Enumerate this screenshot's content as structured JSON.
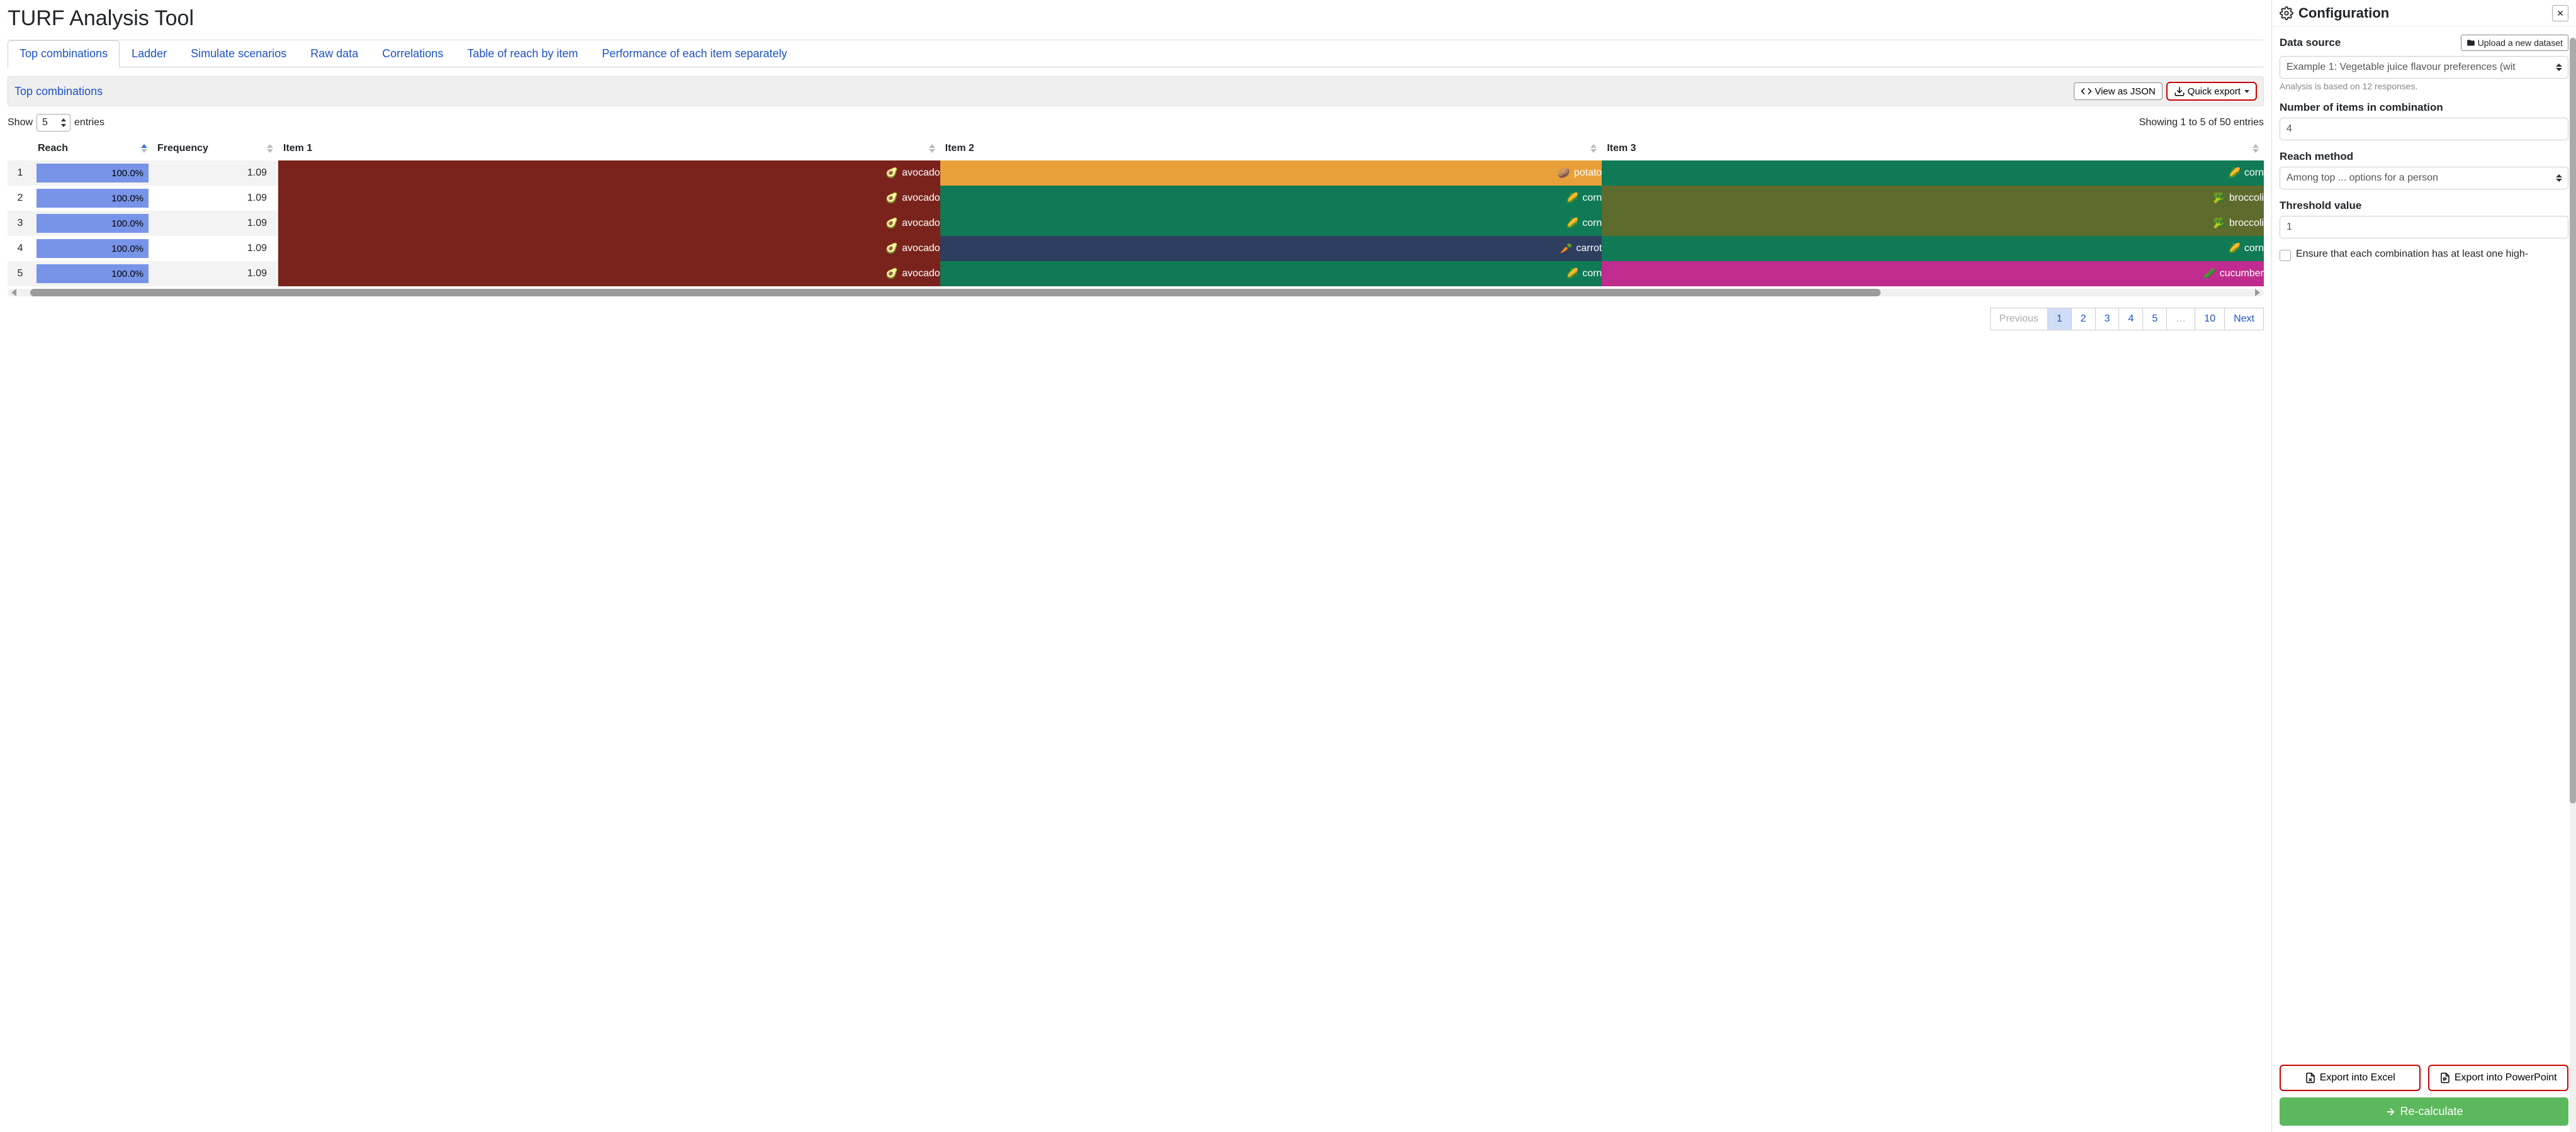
{
  "app_title": "TURF Analysis Tool",
  "tabs": [
    {
      "label": "Top combinations",
      "active": true
    },
    {
      "label": "Ladder",
      "active": false
    },
    {
      "label": "Simulate scenarios",
      "active": false
    },
    {
      "label": "Raw data",
      "active": false
    },
    {
      "label": "Correlations",
      "active": false
    },
    {
      "label": "Table of reach by item",
      "active": false
    },
    {
      "label": "Performance of each item separately",
      "active": false
    }
  ],
  "panel": {
    "title": "Top combinations",
    "view_json_btn": "View as JSON",
    "quick_export_btn": "Quick export"
  },
  "table_controls": {
    "show_label_pre": "Show",
    "show_value": "5",
    "show_label_post": "entries",
    "showing_text": "Showing 1 to 5 of 50 entries"
  },
  "columns": [
    "Reach",
    "Frequency",
    "Item 1",
    "Item 2",
    "Item 3"
  ],
  "item_colors": {
    "avocado": "#7a231c",
    "potato": "#e8a13a",
    "corn": "#0f7a55",
    "broccoli": "#5d6b2d",
    "carrot": "#2d3e5f",
    "cucumber": "#c02b8f"
  },
  "item_emoji": {
    "avocado": "🥑",
    "potato": "🥔",
    "corn": "🌽",
    "broccoli": "🥦",
    "carrot": "🥕",
    "cucumber": "🥒"
  },
  "rows": [
    {
      "idx": "1",
      "reach": "100.0%",
      "freq": "1.09",
      "items": [
        "avocado",
        "potato",
        "corn"
      ]
    },
    {
      "idx": "2",
      "reach": "100.0%",
      "freq": "1.09",
      "items": [
        "avocado",
        "corn",
        "broccoli"
      ]
    },
    {
      "idx": "3",
      "reach": "100.0%",
      "freq": "1.09",
      "items": [
        "avocado",
        "corn",
        "broccoli"
      ]
    },
    {
      "idx": "4",
      "reach": "100.0%",
      "freq": "1.09",
      "items": [
        "avocado",
        "carrot",
        "corn"
      ]
    },
    {
      "idx": "5",
      "reach": "100.0%",
      "freq": "1.09",
      "items": [
        "avocado",
        "corn",
        "cucumber"
      ]
    }
  ],
  "pagination": {
    "previous": "Previous",
    "pages": [
      "1",
      "2",
      "3",
      "4",
      "5",
      "…",
      "10"
    ],
    "active_page": "1",
    "next": "Next"
  },
  "sidebar": {
    "title": "Configuration",
    "data_source": {
      "label": "Data source",
      "upload_btn": "Upload a new dataset",
      "value": "Example 1: Vegetable juice flavour preferences (wit",
      "hint": "Analysis is based on 12 responses."
    },
    "num_items": {
      "label": "Number of items in combination",
      "value": "4"
    },
    "reach_method": {
      "label": "Reach method",
      "value": "Among top ... options for a person"
    },
    "threshold": {
      "label": "Threshold value",
      "value": "1"
    },
    "ensure_label": "Ensure that each combination has at least one high-",
    "export_excel": "Export into Excel",
    "export_ppt": "Export into PowerPoint",
    "recalculate": "Re-calculate"
  }
}
